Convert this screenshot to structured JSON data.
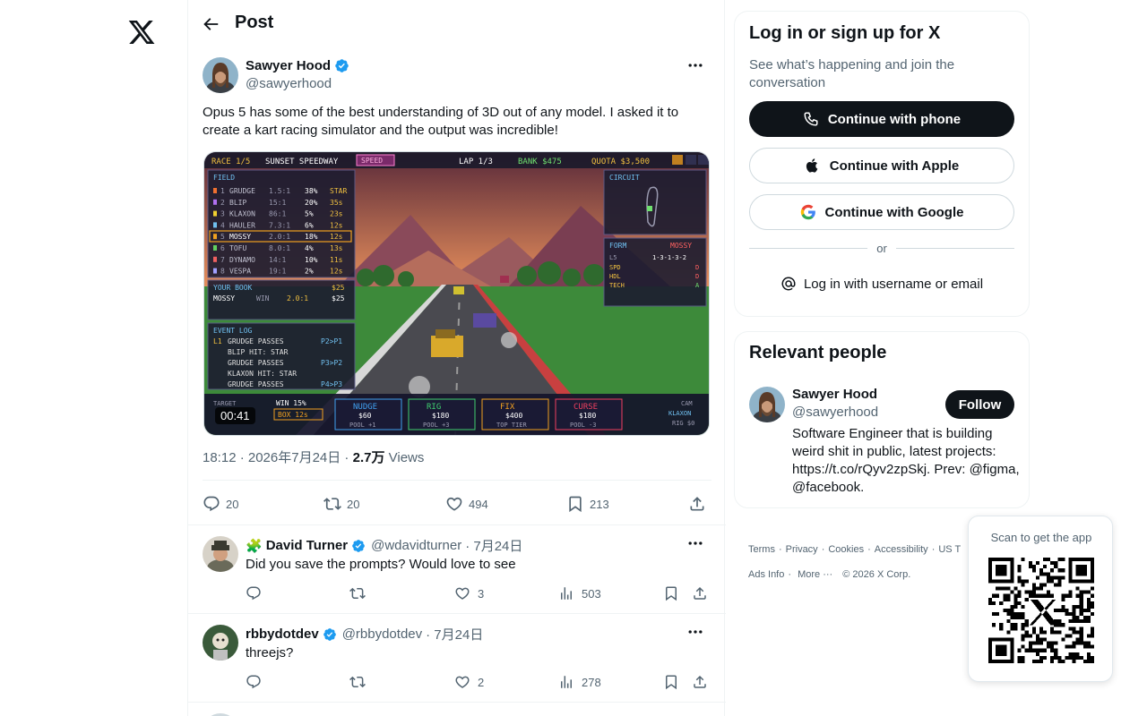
{
  "left_nav": {
    "logo_icon": "x-logo-icon"
  },
  "header": {
    "title": "Post",
    "back_icon": "arrow-left-icon"
  },
  "post": {
    "author_name": "Sawyer Hood",
    "author_handle": "@sawyerhood",
    "text": "Opus 5 has some of the best understanding of 3D out of any model. I asked it to create a kart racing simulator and the output was incredible!",
    "video_time": "00:41",
    "media": {
      "top_bar": {
        "race": "RACE 1/5",
        "track": "SUNSET SPEEDWAY",
        "mode": "SPEED",
        "lap": "LAP 1/3",
        "bank": "BANK $475",
        "quota": "QUOTA $3,500"
      },
      "field_title": "FIELD",
      "field_rows": [
        {
          "pos": "1",
          "name": "GRUDGE",
          "odds": "1.5:1",
          "pct": "38%",
          "tag": "STAR"
        },
        {
          "pos": "2",
          "name": "BLIP",
          "odds": "15:1",
          "pct": "20%",
          "tag": "35s"
        },
        {
          "pos": "3",
          "name": "KLAXON",
          "odds": "86:1",
          "pct": "5%",
          "tag": "23s"
        },
        {
          "pos": "4",
          "name": "HAULER",
          "odds": "7.3:1",
          "pct": "6%",
          "tag": "12s"
        },
        {
          "pos": "5",
          "name": "MOSSY",
          "odds": "2.0:1",
          "pct": "18%",
          "tag": "12s"
        },
        {
          "pos": "6",
          "name": "TOFU",
          "odds": "8.0:1",
          "pct": "4%",
          "tag": "13s"
        },
        {
          "pos": "7",
          "name": "DYNAMO",
          "odds": "14:1",
          "pct": "10%",
          "tag": "11s"
        },
        {
          "pos": "8",
          "name": "VESPA",
          "odds": "19:1",
          "pct": "2%",
          "tag": "12s"
        }
      ],
      "book_title": "YOUR BOOK",
      "book_amount": "$25",
      "book_pick": "MOSSY",
      "book_type": "WIN",
      "book_odds": "2.0:1",
      "book_stake": "$25",
      "log_title": "EVENT LOG",
      "log_rows": [
        {
          "l": "L1",
          "text": "GRUDGE PASSES",
          "r": "P2>P1"
        },
        {
          "l": "",
          "text": "BLIP HIT: STAR",
          "r": ""
        },
        {
          "l": "",
          "text": "GRUDGE PASSES",
          "r": "P3>P2"
        },
        {
          "l": "",
          "text": "KLAXON HIT: STAR",
          "r": ""
        },
        {
          "l": "",
          "text": "GRUDGE PASSES",
          "r": "P4>P3"
        }
      ],
      "circuit_title": "CIRCUIT",
      "form_title": "FORM",
      "form_name": "MOSSY",
      "form_l5": "L5",
      "form_l5_val": "1-3-1-3-2",
      "form_stats": [
        {
          "k": "SPD",
          "v": "D"
        },
        {
          "k": "HDL",
          "v": "D"
        },
        {
          "k": "TECH",
          "v": "A"
        }
      ],
      "target_label": "TARGET",
      "win_label": "WIN 15%",
      "box_label": "BOX 12s",
      "buttons": [
        {
          "label": "NUDGE",
          "price": "$60",
          "sub": "POOL +1"
        },
        {
          "label": "RIG",
          "price": "$180",
          "sub": "POOL +3"
        },
        {
          "label": "FIX",
          "price": "$400",
          "sub": "TOP TIER"
        },
        {
          "label": "CURSE",
          "price": "$180",
          "sub": "POOL -3"
        }
      ],
      "cam_label": "CAM",
      "cam_target": "KLAXON",
      "cam_rig": "RIG $0"
    },
    "timestamp": "18:12 · 2026年7月24日 ·",
    "views_count": "2.7万",
    "views_label": "Views",
    "stats": {
      "replies": "20",
      "reposts": "20",
      "likes": "494",
      "bookmarks": "213"
    }
  },
  "replies": [
    {
      "emoji": "🧩",
      "name": "David Turner",
      "handle": "@wdavidturner",
      "date": "· 7月24日",
      "text": "Did you save the prompts? Would love to see",
      "likes": "3",
      "views": "503"
    },
    {
      "emoji": "",
      "name": "rbbydotdev",
      "handle": "@rbbydotdev",
      "date": "· 7月24日",
      "text": "threejs?",
      "likes": "2",
      "views": "278"
    }
  ],
  "login": {
    "title": "Log in or sign up for X",
    "subtitle": "See what’s happening and join the conversation",
    "phone": "Continue with phone",
    "apple": "Continue with Apple",
    "google": "Continue with Google",
    "or": "or",
    "username": "Log in with username or email"
  },
  "people": {
    "title": "Relevant people",
    "name": "Sawyer Hood",
    "handle": "@sawyerhood",
    "follow": "Follow",
    "bio": "Software Engineer that is building weird shit in public, latest projects: https://t.co/rQyv2zpSkj. Prev: @figma, @facebook."
  },
  "footer": {
    "links_row1": [
      "Terms",
      "Privacy",
      "Cookies",
      "Accessibility",
      "US T"
    ],
    "ads": "Ads Info",
    "more": "More ···",
    "copyright": "© 2026 X Corp."
  },
  "qr": {
    "label": "Scan to get the app"
  },
  "colors": {
    "text": "#0f1419",
    "secondary": "#536471",
    "border": "#eff3f4",
    "verified": "#1d9bf0"
  }
}
